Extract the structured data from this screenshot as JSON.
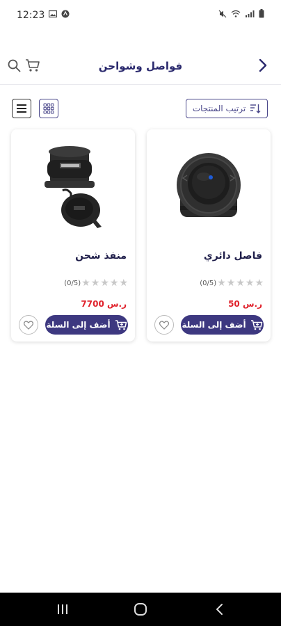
{
  "status_bar": {
    "time": "12:23"
  },
  "header": {
    "title": "فواصل وشواحن",
    "icons": [
      "chevron-right-icon",
      "search-icon",
      "cart-icon"
    ]
  },
  "toolbar": {
    "sort_label": "ترتيب المنتجات",
    "view_modes": [
      "grid",
      "list"
    ]
  },
  "products": [
    {
      "name": "فاصل دائري",
      "rating_text": "(0/5)",
      "rating": 0,
      "price": "50 ر.س",
      "add_label": "أضف إلى السلة"
    },
    {
      "name": "منفذ شحن",
      "rating_text": "(0/5)",
      "rating": 0,
      "price": "7700 ر.س",
      "add_label": "أضف إلى السلة"
    }
  ],
  "colors": {
    "brand": "#3d3880",
    "title": "#2b2a6e",
    "price": "#e0222c",
    "star_empty": "#c8c8c8"
  }
}
